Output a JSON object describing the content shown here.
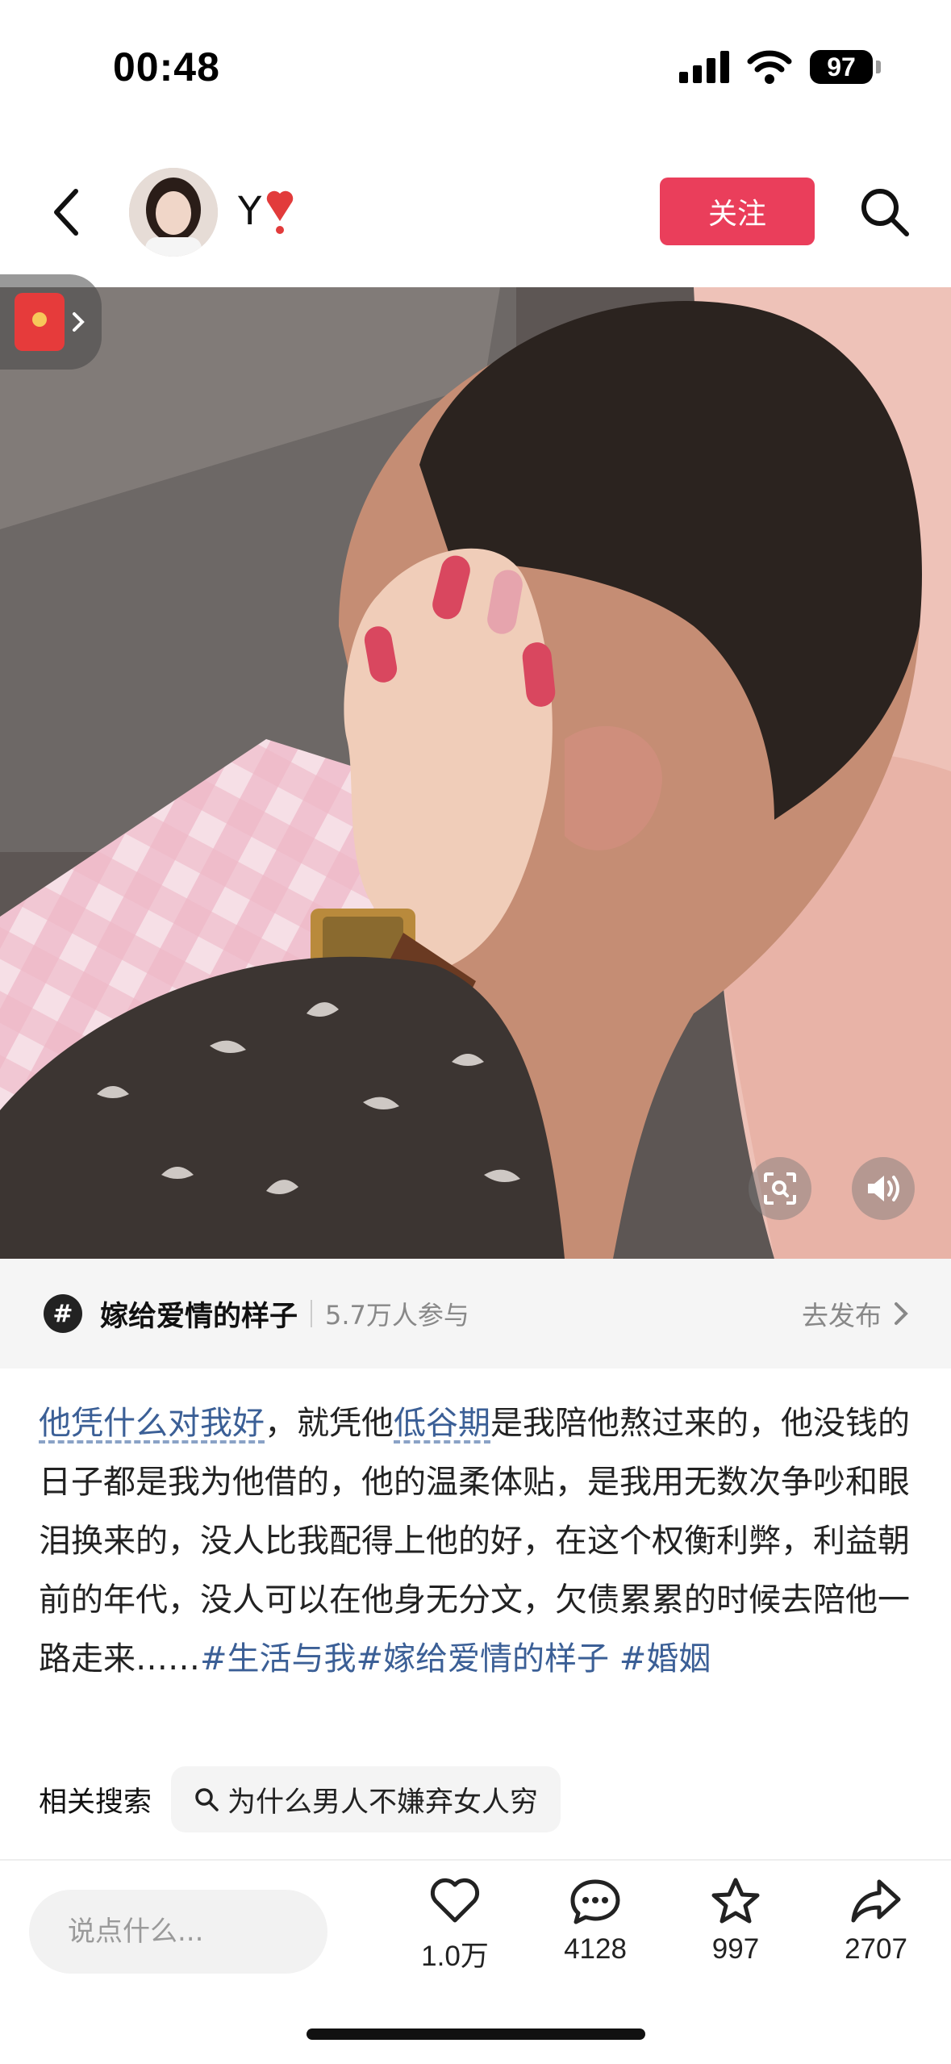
{
  "status_bar": {
    "time": "00:48",
    "battery": "97"
  },
  "header": {
    "username": "Y",
    "follow_label": "关注"
  },
  "topic": {
    "name": "嫁给爱情的样子",
    "participants": "5.7万人参与",
    "action": "去发布"
  },
  "caption": {
    "parts": [
      {
        "text": "他凭什么对我好",
        "style": "link"
      },
      {
        "text": "，就凭他",
        "style": "plain"
      },
      {
        "text": "低谷期",
        "style": "link"
      },
      {
        "text": "是我陪他熬过来的，他没钱的日子都是我为他借的，他的温柔体贴，是我用无数次争吵和眼泪换来的，没人比我配得上他的好，在这个权衡利弊，利益朝前的年代，没人可以在他身无分文，欠债累累的时候去陪他一路走来……",
        "style": "plain"
      },
      {
        "text": "#生活与我",
        "style": "tag"
      },
      {
        "text": "#嫁给爱情的样子",
        "style": "tag"
      },
      {
        "text": " ",
        "style": "plain"
      },
      {
        "text": "#婚姻",
        "style": "tag"
      }
    ]
  },
  "related_search": {
    "label": "相关搜索",
    "query": "为什么男人不嫌弃女人穷"
  },
  "bottom_bar": {
    "comment_placeholder": "说点什么...",
    "likes": "1.0万",
    "comments": "4128",
    "favorites": "997",
    "shares": "2707"
  },
  "colors": {
    "follow_button": "#ea3e5b",
    "link_text": "#3b5f96"
  }
}
